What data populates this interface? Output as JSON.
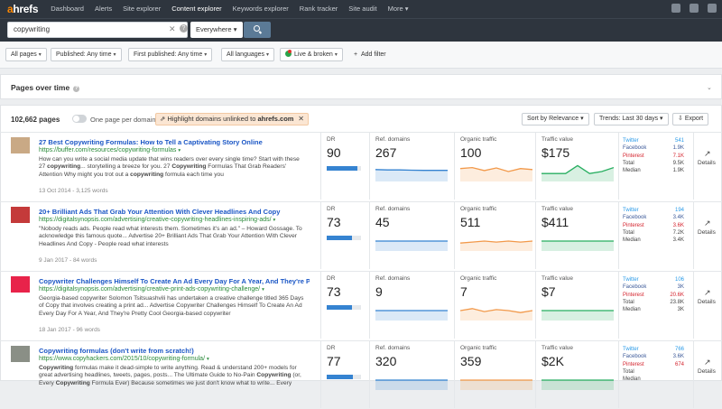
{
  "nav": {
    "logo_a": "a",
    "logo_rest": "hrefs",
    "items": [
      "Dashboard",
      "Alerts",
      "Site explorer",
      "Content explorer",
      "Keywords explorer",
      "Rank tracker",
      "Site audit",
      "More"
    ]
  },
  "search": {
    "query": "copywriting",
    "clear": "✕",
    "help": "?",
    "scope": "Everywhere"
  },
  "filters": {
    "all_pages": "All pages",
    "published": "Published: Any time",
    "first_published": "First published: Any time",
    "languages": "All languages",
    "live_broken": "Live & broken",
    "add_filter": "Add filter"
  },
  "pot": {
    "title": "Pages over time",
    "help": "?"
  },
  "results": {
    "count": "102,662 pages",
    "one_per_domain": "One page per domain",
    "highlight_prefix": "Highlight domains unlinked to ",
    "highlight_domain": "ahrefs.com",
    "sort": "Sort by Relevance",
    "trends": "Trends: Last 30 days",
    "export": "Export"
  },
  "labels": {
    "dr": "DR",
    "ref": "Ref. domains",
    "organic": "Organic traffic",
    "value": "Traffic value",
    "details": "Details",
    "twitter": "Twitter",
    "facebook": "Facebook",
    "pinterest": "Pinterest",
    "total": "Total",
    "median": "Median"
  },
  "rows": [
    {
      "title": "27 Best Copywriting Formulas: How to Tell a Captivating Story Online",
      "url": "https://buffer.com/resources/copywriting-formulas",
      "desc": "How can you write a social media update that wins readers over every single time? Start with these 27 copywriting... storytelling a breeze for you. 27 Copywriting Formulas That Grab Readers' Attention Why might you trot out a copywriting formula each time you",
      "meta": "13 Oct 2014 - 3,125 words",
      "dr": "90",
      "dr_fill": 0.9,
      "ref": "267",
      "organic": "100",
      "value": "$175",
      "twitter": "541",
      "facebook": "1.9K",
      "pinterest": "7.1K",
      "total": "9.5K",
      "median": "1.9K",
      "thumb": "#c9a985"
    },
    {
      "title": "20+ Brilliant Ads That Grab Your Attention With Clever Headlines And Copy",
      "url": "https://digitalsynopsis.com/advertising/creative-copywriting-headlines-inspiring-ads/",
      "desc": "\"Nobody reads ads. People read what interests them. Sometimes it's an ad.\" – Howard Gossage. To acknowledge this famous quote... Advertise 20+ Brilliant Ads That Grab Your Attention With Clever Headlines And Copy - People read what interests",
      "meta": "9 Jan 2017 - 84 words",
      "dr": "73",
      "dr_fill": 0.73,
      "ref": "45",
      "organic": "511",
      "value": "$411",
      "twitter": "194",
      "facebook": "3.4K",
      "pinterest": "3.6K",
      "total": "7.2K",
      "median": "3.4K",
      "thumb": "#c43a3a"
    },
    {
      "title": "Copywriter Challenges Himself To Create An Ad Every Day For A Year, And They're Pr",
      "url": "https://digitalsynopsis.com/advertising/creative-print-ads-copywriting-challenge/",
      "desc": "Georgia-based copywriter Solomon Tsitsuashvili has undertaken a creative challenge titled 365 Days of Copy that involves creating a print ad... Advertise Copywriter Challenges Himself To Create An Ad Every Day For A Year, And They're Pretty Cool Georgia-based copywriter",
      "meta": "18 Jan 2017 - 96 words",
      "dr": "73",
      "dr_fill": 0.73,
      "ref": "9",
      "organic": "7",
      "value": "$7",
      "twitter": "106",
      "facebook": "3K",
      "pinterest": "20.6K",
      "total": "23.8K",
      "median": "3K",
      "thumb": "#e8234a"
    },
    {
      "title": "Copywriting formulas (don't write from scratch!)",
      "url": "https://www.copyhackers.com/2015/10/copywriting-formula/",
      "desc": "Copywriting formulas make it dead-simple to write anything. Read & understand 200+ models for great advertising headlines, tweets, pages, posts... The Ultimate Guide to No-Pain Copywriting (or, Every Copywriting Formula Ever) Because sometimes we just don't know what to write... Every",
      "meta": "",
      "dr": "77",
      "dr_fill": 0.77,
      "ref": "320",
      "organic": "359",
      "value": "$2K",
      "twitter": "766",
      "facebook": "3.6K",
      "pinterest": "674",
      "total": "",
      "median": "",
      "thumb": "#8a8f86"
    }
  ]
}
